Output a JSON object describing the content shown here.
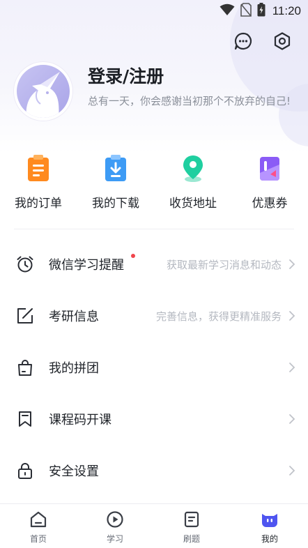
{
  "status_bar": {
    "time": "11:20",
    "icons": [
      "wifi-icon",
      "no-sim-icon",
      "battery-icon"
    ]
  },
  "header": {
    "icons": [
      "message-icon",
      "settings-icon"
    ]
  },
  "profile": {
    "avatar": "unicorn-avatar",
    "login_label": "登录/注册",
    "motto": "总有一天，你会感谢当初那个不放弃的自己!"
  },
  "quick_actions": [
    {
      "label": "我的订单",
      "icon": "order-icon",
      "color": "#ff8a1f"
    },
    {
      "label": "我的下载",
      "icon": "download-icon",
      "color": "#3d9bf5"
    },
    {
      "label": "收货地址",
      "icon": "location-icon",
      "color": "#1fcfa0"
    },
    {
      "label": "优惠券",
      "icon": "coupon-icon",
      "color": "#8b5cf6"
    }
  ],
  "menu": [
    {
      "label": "微信学习提醒",
      "hint": "获取最新学习消息和动态",
      "icon": "alarm-clock-icon",
      "has_dot": true
    },
    {
      "label": "考研信息",
      "hint": "完善信息，获得更精准服务",
      "icon": "edit-icon",
      "has_dot": false
    },
    {
      "label": "我的拼团",
      "hint": "",
      "icon": "shopping-bag-icon",
      "has_dot": false
    },
    {
      "label": "课程码开课",
      "hint": "",
      "icon": "bookmark-icon",
      "has_dot": false
    },
    {
      "label": "安全设置",
      "hint": "",
      "icon": "lock-icon",
      "has_dot": false
    }
  ],
  "tabs": [
    {
      "label": "首页",
      "icon": "home-icon",
      "active": false
    },
    {
      "label": "学习",
      "icon": "play-icon",
      "active": false
    },
    {
      "label": "刷题",
      "icon": "document-icon",
      "active": false
    },
    {
      "label": "我的",
      "icon": "mascot-icon",
      "active": true
    }
  ],
  "colors": {
    "accent": "#4f55f0",
    "dot": "#f0454c"
  }
}
